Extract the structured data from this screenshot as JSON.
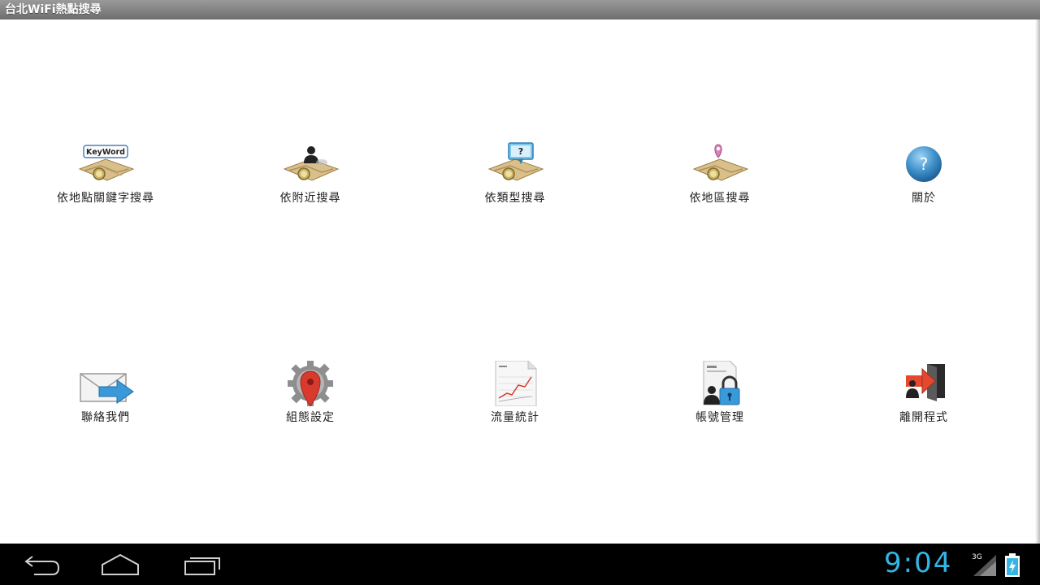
{
  "app": {
    "title": "台北WiFi熱點搜尋"
  },
  "menu": {
    "items": [
      {
        "label": "依地點關鍵字搜尋",
        "icon": "keyword-map-icon",
        "badge": "KeyWord"
      },
      {
        "label": "依附近搜尋",
        "icon": "nearby-person-map-icon"
      },
      {
        "label": "依類型搜尋",
        "icon": "type-question-map-icon",
        "badge": "?"
      },
      {
        "label": "依地區搜尋",
        "icon": "area-pin-map-icon"
      },
      {
        "label": "關於",
        "icon": "help-icon",
        "badge": "?"
      },
      {
        "label": "聯絡我們",
        "icon": "mail-send-icon"
      },
      {
        "label": "組態設定",
        "icon": "settings-pin-icon"
      },
      {
        "label": "流量統計",
        "icon": "report-chart-icon"
      },
      {
        "label": "帳號管理",
        "icon": "account-lock-icon"
      },
      {
        "label": "離開程式",
        "icon": "exit-door-icon"
      }
    ]
  },
  "statusbar": {
    "time": "9:04",
    "network": "3G"
  },
  "colors": {
    "accent": "#33b5e5",
    "titlebar": "#7f7f7f",
    "navbar": "#000000"
  }
}
